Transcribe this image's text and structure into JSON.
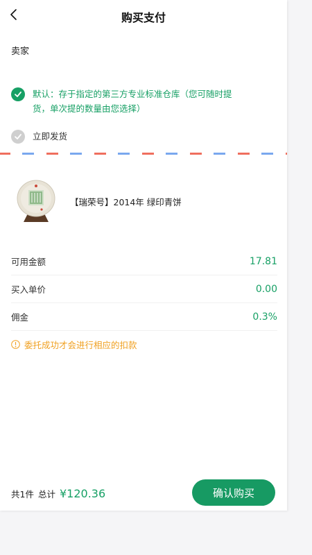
{
  "header": {
    "title": "购买支付"
  },
  "seller": {
    "label": "卖家"
  },
  "options": [
    {
      "text": "默认：存于指定的第三方专业标准仓库（您可随时提货，单次提的数量由您选择）",
      "selected": true
    },
    {
      "text": "立即发货",
      "selected": false
    }
  ],
  "product": {
    "name": "【瑞荣号】2014年 绿印青饼"
  },
  "details": [
    {
      "label": "可用金额",
      "value": "17.81"
    },
    {
      "label": "买入单价",
      "value": "0.00"
    },
    {
      "label": "佣金",
      "value": "0.3%"
    }
  ],
  "notice": {
    "text": "委托成功才会进行相应的扣款"
  },
  "footer": {
    "count": "共1件",
    "total_label": "总计",
    "price": "¥120.36",
    "confirm_label": "确认购买"
  },
  "colors": {
    "accent": "#17a065",
    "warning": "#f0a020",
    "airmail_red": "#ef6f5e",
    "airmail_blue": "#7aa8ee"
  }
}
